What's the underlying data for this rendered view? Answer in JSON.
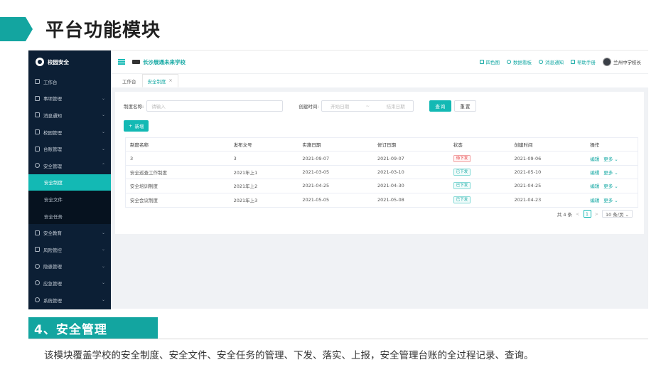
{
  "slide": {
    "title": "平台功能模块",
    "section_title": "4、安全管理",
    "description": "该模块覆盖学校的安全制度、安全文件、安全任务的管理、下发、落实、上报，安全管理台账的全过程记录、查询。",
    "accent_color": "#13a5a0"
  },
  "sidebar": {
    "brand": "校园安全",
    "items": [
      {
        "label": "工作台",
        "icon": "dashboard-icon",
        "caret": ""
      },
      {
        "label": "事项管理",
        "icon": "calendar-icon",
        "caret": "⌄"
      },
      {
        "label": "消息通知",
        "icon": "megaphone-icon",
        "caret": "⌄"
      },
      {
        "label": "校园管理",
        "icon": "home-icon",
        "caret": "⌄"
      },
      {
        "label": "台账管理",
        "icon": "ledger-icon",
        "caret": "⌄"
      },
      {
        "label": "安全管理",
        "icon": "shield-icon",
        "caret": "⌃"
      }
    ],
    "sub_items": [
      {
        "label": "安全制度",
        "active": true
      },
      {
        "label": "安全文件",
        "active": false
      },
      {
        "label": "安全任务",
        "active": false
      }
    ],
    "items_after": [
      {
        "label": "安全教育",
        "icon": "book-icon",
        "caret": "⌄"
      },
      {
        "label": "风险管控",
        "icon": "flag-icon",
        "caret": "⌄"
      },
      {
        "label": "隐患管理",
        "icon": "wrench-icon",
        "caret": "⌄"
      },
      {
        "label": "应急管理",
        "icon": "alarm-icon",
        "caret": "⌄"
      },
      {
        "label": "系统管理",
        "icon": "gear-icon",
        "caret": "⌄"
      }
    ]
  },
  "topbar": {
    "school": "长沙展通未来学校",
    "links": [
      "四色图",
      "数据看板",
      "消息通知",
      "帮助手册"
    ],
    "user": "兰州中学校长"
  },
  "tabs": [
    {
      "label": "工作台",
      "active": false,
      "closable": false
    },
    {
      "label": "安全制度",
      "active": true,
      "closable": true
    }
  ],
  "filter": {
    "name_label": "制度名称:",
    "name_placeholder": "请输入",
    "date_label": "创建时间:",
    "date_start": "开始日期",
    "date_sep": "~",
    "date_end": "结束日期",
    "search_btn": "查询",
    "reset_btn": "重置",
    "add_btn": "新增"
  },
  "table": {
    "headers": [
      "制度名称",
      "发布文号",
      "实施日期",
      "修订日期",
      "状态",
      "创建时间",
      "操作"
    ],
    "rows": [
      {
        "name": "3",
        "doc_no": "3",
        "effective": "2021-09-07",
        "revised": "2021-09-07",
        "status": "待下发",
        "status_type": "warn",
        "created": "2021-09-06"
      },
      {
        "name": "安全巡查工作制度",
        "doc_no": "2021年上1",
        "effective": "2021-03-05",
        "revised": "2021-03-10",
        "status": "已下发",
        "status_type": "ok",
        "created": "2021-05-10"
      },
      {
        "name": "安全培训制度",
        "doc_no": "2021年上2",
        "effective": "2021-04-25",
        "revised": "2021-04-30",
        "status": "已下发",
        "status_type": "ok",
        "created": "2021-04-25"
      },
      {
        "name": "安全会议制度",
        "doc_no": "2021年上3",
        "effective": "2021-05-05",
        "revised": "2021-05-08",
        "status": "已下发",
        "status_type": "ok",
        "created": "2021-04-23"
      }
    ],
    "op_edit": "编辑",
    "op_more": "更多 ⌄"
  },
  "pager": {
    "total": "共 4 条",
    "prev": "<",
    "page": "1",
    "next": ">",
    "size": "10 条/页 ⌄"
  }
}
